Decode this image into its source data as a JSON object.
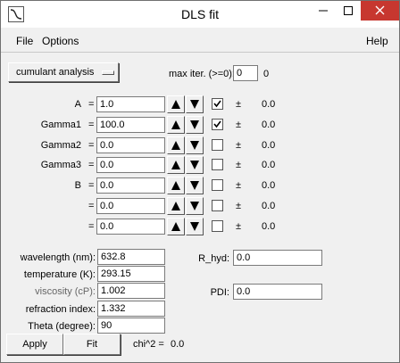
{
  "window": {
    "title": "DLS fit"
  },
  "menu": {
    "file": "File",
    "options": "Options",
    "help": "Help"
  },
  "method": {
    "label": "cumulant analysis"
  },
  "max_iter": {
    "label": "max iter. (>=0):",
    "value": "0",
    "result": "0"
  },
  "params": [
    {
      "label": "A",
      "value": "1.0",
      "checked": true,
      "pm": "±",
      "err": "0.0"
    },
    {
      "label": "Gamma1",
      "value": "100.0",
      "checked": true,
      "pm": "±",
      "err": "0.0"
    },
    {
      "label": "Gamma2",
      "value": "0.0",
      "checked": false,
      "pm": "±",
      "err": "0.0"
    },
    {
      "label": "Gamma3",
      "value": "0.0",
      "checked": false,
      "pm": "±",
      "err": "0.0"
    },
    {
      "label": "B",
      "value": "0.0",
      "checked": false,
      "pm": "±",
      "err": "0.0"
    },
    {
      "label": "",
      "value": "0.0",
      "checked": false,
      "pm": "±",
      "err": "0.0"
    },
    {
      "label": "",
      "value": "0.0",
      "checked": false,
      "pm": "±",
      "err": "0.0"
    }
  ],
  "eq": "=",
  "props": [
    {
      "label": "wavelength (nm):",
      "value": "632.8"
    },
    {
      "label": "temperature (K):",
      "value": "293.15"
    },
    {
      "label": "viscosity (cP):",
      "value": "1.002"
    },
    {
      "label": "refraction index:",
      "value": "1.332"
    },
    {
      "label": "Theta (degree):",
      "value": "90"
    }
  ],
  "results": {
    "r_hyd_label": "R_hyd:",
    "r_hyd_value": "0.0",
    "pdi_label": "PDI:",
    "pdi_value": "0.0"
  },
  "actions": {
    "apply": "Apply",
    "fit": "Fit",
    "chi2_label": "chi^2 =",
    "chi2_value": "0.0"
  }
}
